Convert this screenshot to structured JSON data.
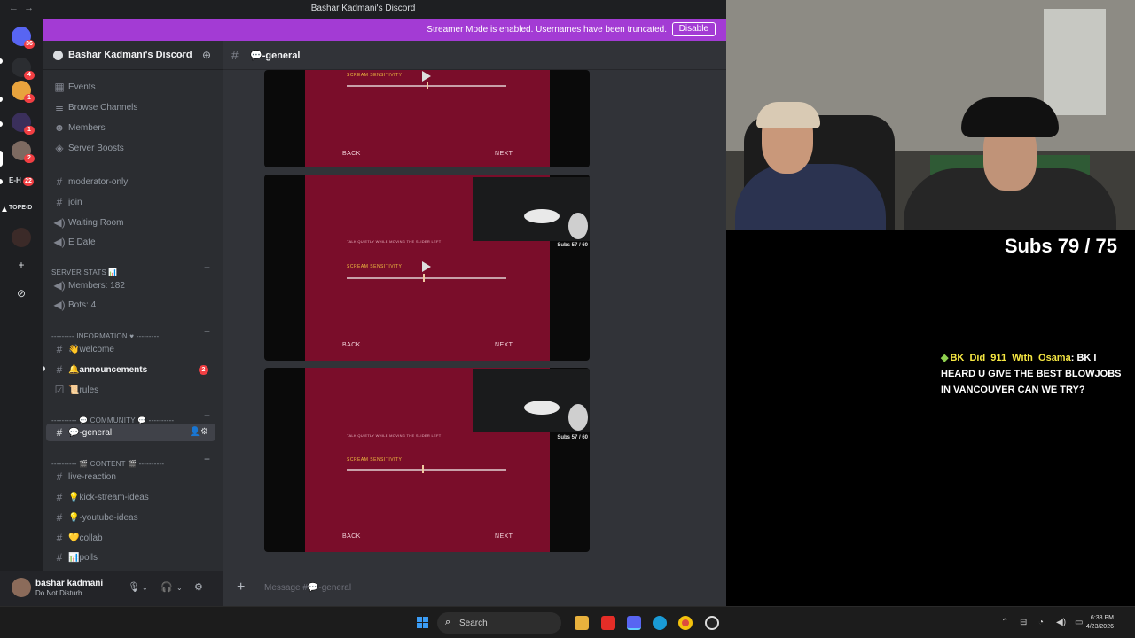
{
  "window": {
    "title": "Bashar Kadmani's Discord",
    "back_glyph": "←",
    "fwd_glyph": "→"
  },
  "banner": {
    "message": "Streamer Mode is enabled. Usernames have been truncated.",
    "disable_label": "Disable"
  },
  "rail": {
    "badges": [
      "36",
      "4",
      "1",
      "1",
      "2",
      "22"
    ],
    "text_items": [
      "E-H",
      "TOPE-D"
    ]
  },
  "server": {
    "name": "Bashar Kadmani's Discord"
  },
  "sidebar": {
    "top_items": [
      {
        "label": "Events",
        "icon": "calendar-icon"
      },
      {
        "label": "Browse Channels",
        "icon": "browse-icon"
      },
      {
        "label": "Members",
        "icon": "members-icon"
      },
      {
        "label": "Server Boosts",
        "icon": "boost-icon"
      }
    ],
    "channels1": [
      {
        "label": "moderator-only",
        "icon": "hash-icon"
      },
      {
        "label": "join",
        "icon": "hash-icon"
      },
      {
        "label": "Waiting Room",
        "icon": "speaker-icon"
      },
      {
        "label": "E Date",
        "icon": "speaker-icon"
      }
    ],
    "cat_stats": "SERVER STATS 📊",
    "stats": [
      {
        "label": "Members: 182",
        "icon": "speaker-icon"
      },
      {
        "label": "Bots: 4",
        "icon": "speaker-icon"
      }
    ],
    "cat_info": "--------- INFORMATION ♥ ---------",
    "info": [
      {
        "label": "👋welcome",
        "icon": "hash-icon"
      },
      {
        "label": "🔔announcements",
        "icon": "hash-icon",
        "badge": "2"
      },
      {
        "label": "📜rules",
        "icon": "rules-icon"
      }
    ],
    "cat_community": "---------- 💬 COMMUNITY 💬 ----------",
    "community": [
      {
        "label": "💬-general",
        "icon": "hash-icon"
      }
    ],
    "cat_content": "---------- 🎬 CONTENT 🎬 ----------",
    "content": [
      {
        "label": "live-reaction",
        "icon": "hash-icon"
      },
      {
        "label": "💡kick-stream-ideas",
        "icon": "hash-icon"
      },
      {
        "label": "💡-youtube-ideas",
        "icon": "hash-icon"
      },
      {
        "label": "💛collab",
        "icon": "hash-icon"
      },
      {
        "label": "📊polls",
        "icon": "hash-icon"
      }
    ]
  },
  "user": {
    "name": "bashar kadmani",
    "status": "Do Not Disturb"
  },
  "chat": {
    "channel_name": "💬-general",
    "placeholder": "Message #💬-general",
    "cards": [
      {
        "sens_label": "SCREAM SENSITIVITY",
        "back": "BACK",
        "next": "NEXT",
        "subs": "",
        "hint": ""
      },
      {
        "sens_label": "SCREAM SENSITIVITY",
        "back": "BACK",
        "next": "NEXT",
        "subs": "Subs 57 / 60",
        "hint": "TALK QUIETLY WHILE MOVING THE SLIDER LEFT"
      },
      {
        "sens_label": "SCREAM SENSITIVITY",
        "back": "BACK",
        "next": "NEXT",
        "subs": "Subs 57 / 60",
        "hint": "TALK QUIETLY WHILE MOVING THE SLIDER LEFT"
      }
    ],
    "slider_levels": [
      0.5,
      0.48,
      0.47
    ]
  },
  "overlay": {
    "subs": "Subs 79 / 75",
    "chat_user": "BK_Did_911_With_Osama",
    "chat_text": ": BK I HEARD U GIVE THE BEST BLOWJOBS IN VANCOUVER CAN WE TRY?"
  },
  "taskbar": {
    "search": "Search",
    "time": "6:38 PM",
    "date": "4/23/2026"
  },
  "colors": {
    "accent": "#a33bd4",
    "game_bg": "#7a0d2a",
    "discord_bg": "#313338"
  }
}
